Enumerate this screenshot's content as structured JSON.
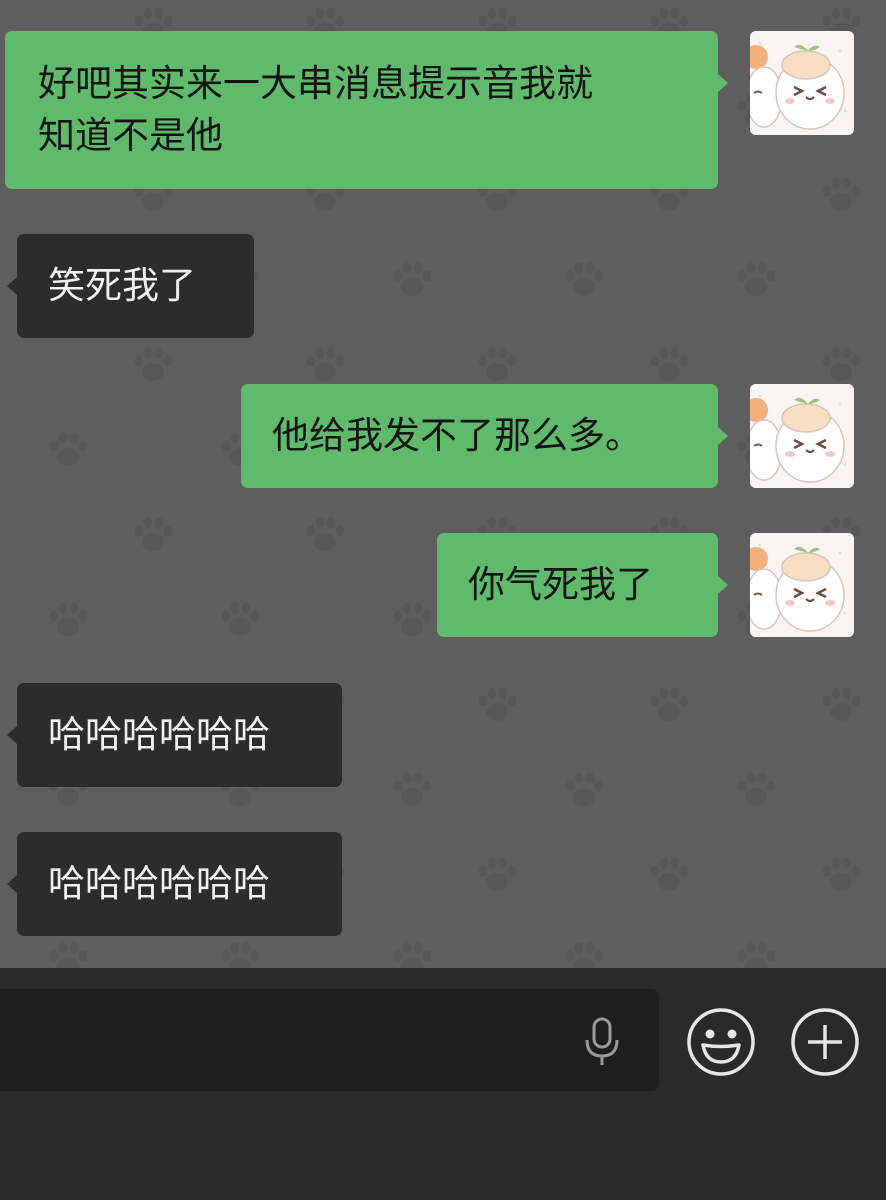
{
  "messages": [
    {
      "direction": "outgoing",
      "text": "好吧其实来一大串消息提示音我就知道不是他",
      "lines": [
        "好吧其实来一大串消息提示音我就",
        "知道不是他"
      ]
    },
    {
      "direction": "incoming",
      "text": "笑死我了"
    },
    {
      "direction": "outgoing",
      "text": "他给我发不了那么多。"
    },
    {
      "direction": "outgoing",
      "text": "你气死我了"
    },
    {
      "direction": "incoming",
      "text": "哈哈哈哈哈哈"
    },
    {
      "direction": "incoming",
      "text": "哈哈哈哈哈哈"
    }
  ],
  "colors": {
    "outgoing_bubble": "#5fba6b",
    "incoming_bubble": "#2c2c2c",
    "chat_background": "#5e5e5e",
    "input_bar": "#2a2a2a"
  },
  "input_bar": {
    "icons": [
      "microphone-icon",
      "emoji-icon",
      "plus-icon"
    ]
  }
}
